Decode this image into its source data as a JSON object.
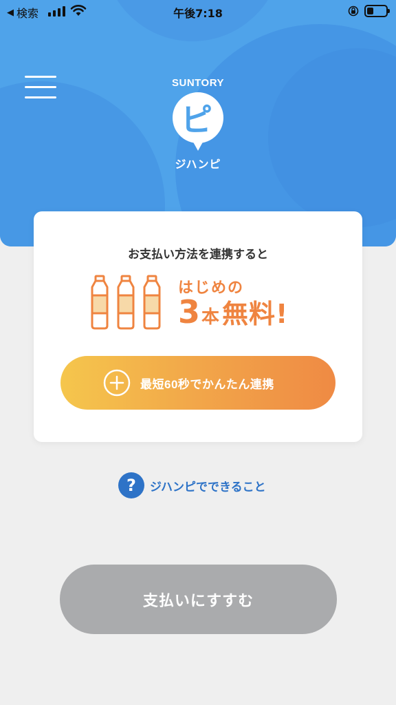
{
  "status_bar": {
    "back_label": "検索",
    "time": "午後7:18"
  },
  "header": {
    "brand_maker": "SUNTORY",
    "logo_letter": "ピ",
    "app_name": "ジハンピ"
  },
  "card": {
    "lead_text": "お支払い方法を連携すると",
    "promo_line1": "はじめの",
    "promo_number": "3",
    "promo_unit": "本",
    "promo_free": "無料!",
    "link_button_label": "最短60秒でかんたん連携"
  },
  "help": {
    "icon_char": "?",
    "label": "ジハンピでできること"
  },
  "pay_button": {
    "label": "支払いにすすむ",
    "state": "disabled"
  },
  "colors": {
    "header_blue": "#4fa3ea",
    "promo_orange": "#ef8440",
    "gradient_start": "#f5c64c",
    "gradient_end": "#ef8a44",
    "help_blue": "#2e73c7",
    "disabled_gray": "#aaabad"
  }
}
